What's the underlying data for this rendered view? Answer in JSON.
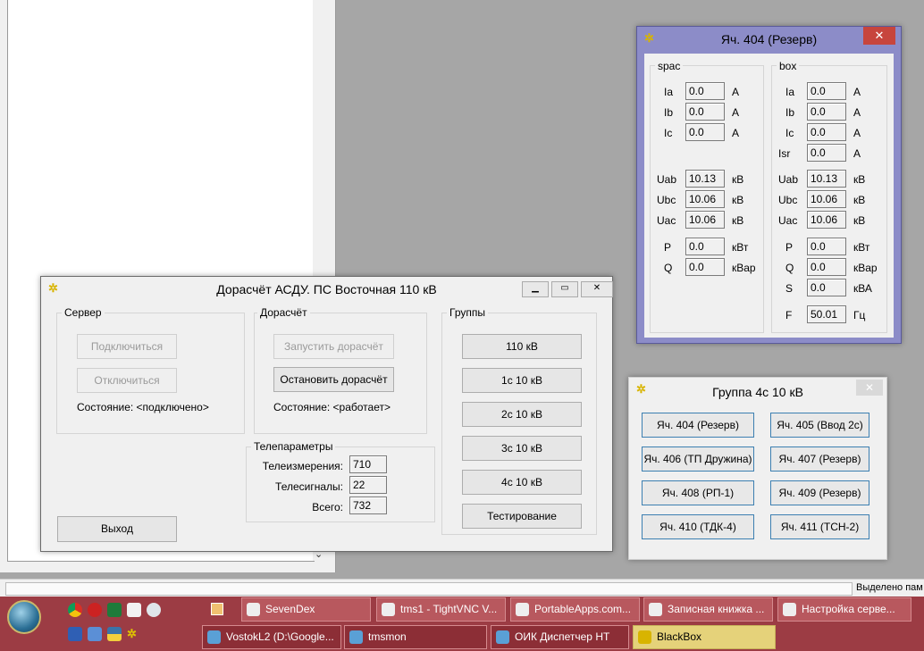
{
  "statusbar": {
    "text": "Выделено пам"
  },
  "main_window": {
    "title": "Дорасчёт АСДУ. ПС Восточная 110 кВ",
    "server": {
      "group_label": "Сервер",
      "connect": "Подключиться",
      "disconnect": "Отключиться",
      "status": "Состояние: <подключено>"
    },
    "calc": {
      "group_label": "Дорасчёт",
      "start": "Запустить дорасчёт",
      "stop": "Остановить дорасчёт",
      "status": "Состояние: <работает>"
    },
    "tele": {
      "group_label": "Телепараметры",
      "rows": [
        {
          "label": "Телеизмерения:",
          "value": "710"
        },
        {
          "label": "Телесигналы:",
          "value": "22"
        },
        {
          "label": "Всего:",
          "value": "732"
        }
      ]
    },
    "groups": {
      "group_label": "Группы",
      "buttons": [
        "110 кВ",
        "1с 10 кВ",
        "2с 10 кВ",
        "3с 10 кВ",
        "4с 10 кВ",
        "Тестирование"
      ]
    },
    "exit": "Выход"
  },
  "cell_window": {
    "title": "Яч. 404 (Резерв)",
    "spac": {
      "group_label": "spac",
      "rows": [
        {
          "label": "Ia",
          "value": "0.0",
          "unit": "А"
        },
        {
          "label": "Ib",
          "value": "0.0",
          "unit": "А"
        },
        {
          "label": "Ic",
          "value": "0.0",
          "unit": "А"
        },
        {
          "label": "Uab",
          "value": "10.13",
          "unit": "кВ"
        },
        {
          "label": "Ubc",
          "value": "10.06",
          "unit": "кВ"
        },
        {
          "label": "Uac",
          "value": "10.06",
          "unit": "кВ"
        },
        {
          "label": "P",
          "value": "0.0",
          "unit": "кВт"
        },
        {
          "label": "Q",
          "value": "0.0",
          "unit": "кВар"
        }
      ]
    },
    "box": {
      "group_label": "box",
      "rows": [
        {
          "label": "Ia",
          "value": "0.0",
          "unit": "А"
        },
        {
          "label": "Ib",
          "value": "0.0",
          "unit": "А"
        },
        {
          "label": "Ic",
          "value": "0.0",
          "unit": "А"
        },
        {
          "label": "Isr",
          "value": "0.0",
          "unit": "А"
        },
        {
          "label": "Uab",
          "value": "10.13",
          "unit": "кВ"
        },
        {
          "label": "Ubc",
          "value": "10.06",
          "unit": "кВ"
        },
        {
          "label": "Uac",
          "value": "10.06",
          "unit": "кВ"
        },
        {
          "label": "P",
          "value": "0.0",
          "unit": "кВт"
        },
        {
          "label": "Q",
          "value": "0.0",
          "unit": "кВар"
        },
        {
          "label": "S",
          "value": "0.0",
          "unit": "кВА"
        },
        {
          "label": "F",
          "value": "50.01",
          "unit": "Гц"
        }
      ]
    }
  },
  "group_window": {
    "title": "Группа 4с 10 кВ",
    "buttons": [
      "Яч. 404 (Резерв)",
      "Яч. 405 (Ввод 2с)",
      "Яч. 406 (ТП Дружина)",
      "Яч. 407 (Резерв)",
      "Яч. 408 (РП-1)",
      "Яч. 409 (Резерв)",
      "Яч. 410 (ТДК-4)",
      "Яч. 411 (ТСН-2)"
    ]
  },
  "taskbar": {
    "row1": [
      "SevenDex",
      "tms1 - TightVNC V...",
      "PortableApps.com...",
      "Записная книжка ...",
      "Настройка серве..."
    ],
    "row2": [
      "VostokL2 (D:\\Google...",
      "tmsmon",
      "ОИК Диспетчер НТ",
      "BlackBox"
    ]
  },
  "colors": {
    "taskbar": "#9c3c44",
    "cell_title_active": "#8c8cc8",
    "close_red": "#c7453d",
    "accent_blue": "#3c7fb1"
  }
}
